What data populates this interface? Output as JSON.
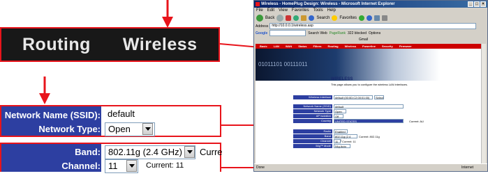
{
  "callout_nav": {
    "routing": "Routing",
    "wireless": "Wireless"
  },
  "callout_ssid": {
    "network_name_label": "Network Name (SSID):",
    "network_name_value": "default",
    "network_type_label": "Network Type:",
    "network_type_value": "Open"
  },
  "callout_band": {
    "band_label": "Band:",
    "band_value": "802.11g (2.4 GHz)",
    "band_current": "Curre",
    "channel_label": "Channel:",
    "channel_value": "11",
    "channel_current": "Current: 11"
  },
  "browser": {
    "title": "Wireless - HomePlug Design: Wireless - Microsoft Internet Explorer",
    "menu": [
      "File",
      "Edit",
      "View",
      "Favorites",
      "Tools",
      "Help"
    ],
    "back": "Back",
    "search": "Search",
    "favorites": "Favorites",
    "address_label": "Address",
    "address": "http://10.0.0.1/wireless.asp",
    "go": "Go",
    "google_label": "Google",
    "search_web": "Search Web",
    "pagerank": "PageRank",
    "blocked": "322 blocked",
    "options": "Options",
    "gmail": "Gmail",
    "nav_items": [
      "Basic",
      "LAN",
      "WAN",
      "Status",
      "Filters",
      "Routing",
      "Wireless",
      "Powerline",
      "Security",
      "Firmware"
    ],
    "heading": "WIRELESS",
    "description": "This page allows you to configure the wireless LAN interfaces.",
    "wireless_interface_label": "Wireless Interface",
    "wireless_interface_value": "default (00:0D:C2:00:01:00)",
    "select_btn": "Select",
    "ssid_label": "Network Name (SSID)",
    "ssid_value": "default",
    "type_label": "Network Type",
    "type_value": "Open",
    "ap_label": "AP Isolation",
    "ap_value": "Off",
    "country_label": "Country",
    "country_value": "UNITED STATES",
    "country_current": "Current: AU",
    "radio_label": "Radio",
    "radio_value": "Enabled",
    "band_label": "Band",
    "band_value": "802.11g (2.4 GHz)",
    "band_current": "Current: 802.11g",
    "channel_label": "Channel",
    "channel_value": "11",
    "channel_current": "Current: 11",
    "mode_label": "54g™ Mode",
    "mode_value": "54g Auto",
    "status_done": "Done",
    "status_zone": "Internet",
    "banner_digits": "01011101 00111011"
  },
  "colors": {
    "accent_red": "#e8141b",
    "label_blue": "#2d3fa1"
  }
}
